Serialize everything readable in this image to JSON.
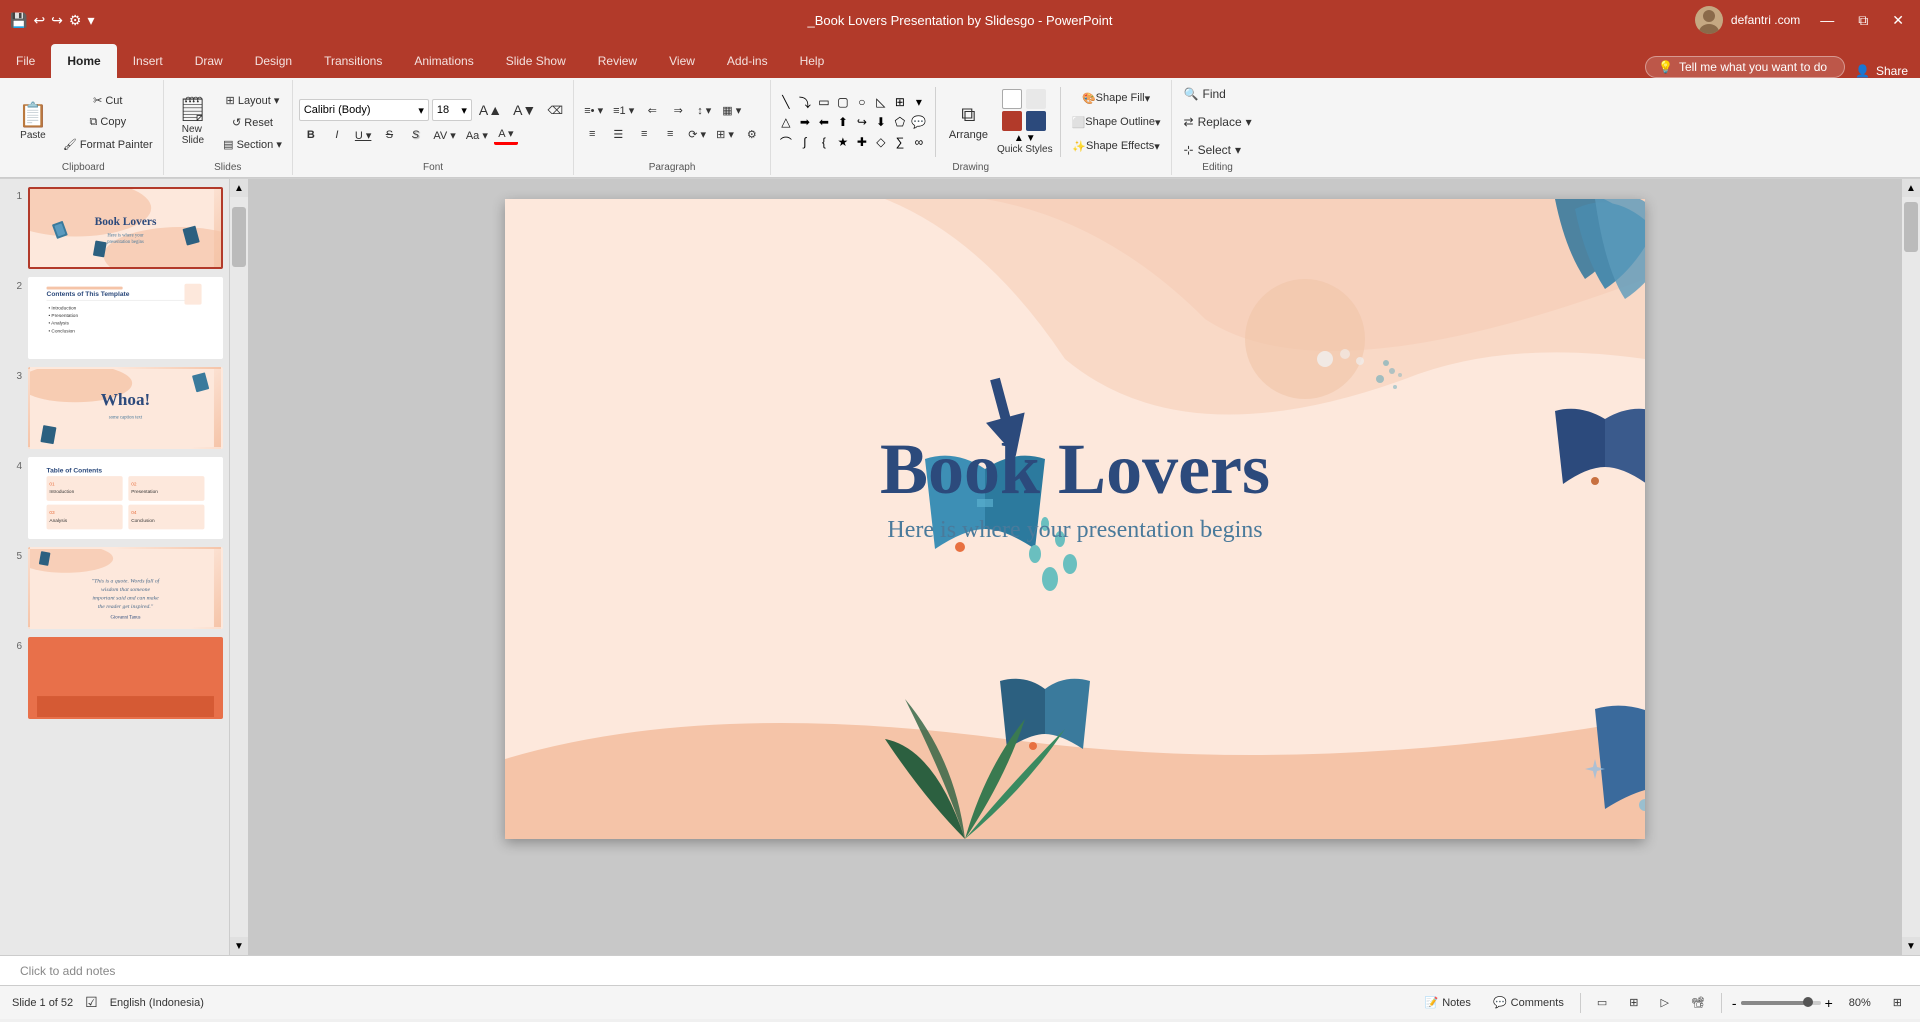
{
  "titlebar": {
    "title": "_Book Lovers Presentation by Slidesgo - PowerPoint",
    "user": "defantri .com",
    "save_icon": "💾",
    "undo_icon": "↩",
    "redo_icon": "↪",
    "customize_icon": "⚙",
    "dropdown_icon": "▾",
    "minimize_icon": "—",
    "restore_icon": "⧉",
    "close_icon": "✕"
  },
  "tabs": [
    {
      "label": "File",
      "active": false
    },
    {
      "label": "Home",
      "active": true
    },
    {
      "label": "Insert",
      "active": false
    },
    {
      "label": "Draw",
      "active": false
    },
    {
      "label": "Design",
      "active": false
    },
    {
      "label": "Transitions",
      "active": false
    },
    {
      "label": "Animations",
      "active": false
    },
    {
      "label": "Slide Show",
      "active": false
    },
    {
      "label": "Review",
      "active": false
    },
    {
      "label": "View",
      "active": false
    },
    {
      "label": "Add-ins",
      "active": false
    },
    {
      "label": "Help",
      "active": false
    }
  ],
  "toolbar": {
    "clipboard": {
      "label": "Clipboard",
      "paste_label": "Paste",
      "cut_label": "Cut",
      "copy_label": "Copy",
      "format_painter_label": "Format Painter"
    },
    "slides": {
      "label": "Slides",
      "new_slide_label": "New\nSlide",
      "layout_label": "Layout",
      "reset_label": "Reset",
      "section_label": "Section"
    },
    "font": {
      "label": "Font",
      "font_name": "Calibri (Body)",
      "font_size": "18",
      "bold": "B",
      "italic": "I",
      "underline": "U",
      "strikethrough": "S",
      "shadow": "S",
      "char_spacing": "AV",
      "case": "Aa",
      "font_color": "A",
      "increase_size": "▲",
      "decrease_size": "▼",
      "clear_format": "⌫"
    },
    "paragraph": {
      "label": "Paragraph",
      "bullets_label": "Bullets",
      "numbering_label": "Numbering",
      "decrease_indent": "⇐",
      "increase_indent": "⇒",
      "line_spacing": "≡",
      "columns": "▦",
      "align_left": "≡",
      "align_center": "≡",
      "align_right": "≡",
      "justify": "≡",
      "text_direction": "⟳",
      "align_text": "⊞",
      "smartart": "⚙"
    },
    "drawing": {
      "label": "Drawing",
      "shape_fill_label": "Shape Fill",
      "shape_outline_label": "Shape Outline",
      "shape_effects_label": "Shape Effects",
      "arrange_label": "Arrange",
      "quick_styles_label": "Quick\nStyles"
    },
    "editing": {
      "label": "Editing",
      "find_label": "Find",
      "replace_label": "Replace",
      "select_label": "Select"
    }
  },
  "tellme": {
    "placeholder": "Tell me what you want to do",
    "icon": "💡"
  },
  "share": {
    "label": "Share",
    "icon": "👤"
  },
  "slides": [
    {
      "num": 1,
      "active": true,
      "thumb_class": "thumb-slide1",
      "title": "Book Lovers",
      "subtitle": "Here is where your presentation begins"
    },
    {
      "num": 2,
      "active": false,
      "thumb_class": "thumb-slide2",
      "title": "Contents of This Template",
      "subtitle": ""
    },
    {
      "num": 3,
      "active": false,
      "thumb_class": "thumb-slide3",
      "title": "Whoa!",
      "subtitle": ""
    },
    {
      "num": 4,
      "active": false,
      "thumb_class": "thumb-slide4",
      "title": "Table of Contents",
      "subtitle": ""
    },
    {
      "num": 5,
      "active": false,
      "thumb_class": "thumb-slide5",
      "title": "",
      "subtitle": ""
    },
    {
      "num": 6,
      "active": false,
      "thumb_class": "thumb-slide6",
      "title": "",
      "subtitle": ""
    }
  ],
  "slide": {
    "title": "Book Lovers",
    "subtitle": "Here is where your presentation begins"
  },
  "notes": {
    "placeholder": "Click to add notes",
    "tab_label": "Notes",
    "comments_label": "Comments"
  },
  "status": {
    "slide_info": "Slide 1 of 52",
    "language": "English (Indonesia)",
    "accessibility": "✓",
    "zoom": "80%",
    "fit_icon": "⊞",
    "normal_view": "▭",
    "slide_sorter": "⊞",
    "reading_view": "▷",
    "presenter_view": "📽"
  }
}
